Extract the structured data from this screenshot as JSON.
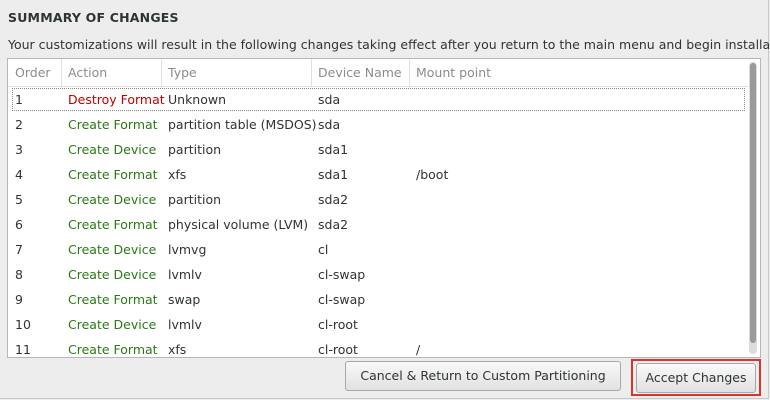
{
  "dialog": {
    "title": "SUMMARY OF CHANGES",
    "subtitle": "Your customizations will result in the following changes taking effect after you return to the main menu and begin installation:"
  },
  "table": {
    "columns": {
      "order": "Order",
      "action": "Action",
      "type": "Type",
      "device": "Device Name",
      "mount": "Mount point"
    },
    "rows": [
      {
        "order": "1",
        "action": "Destroy Format",
        "type": "Unknown",
        "device": "sda",
        "mount": ""
      },
      {
        "order": "2",
        "action": "Create Format",
        "type": "partition table (MSDOS)",
        "device": "sda",
        "mount": ""
      },
      {
        "order": "3",
        "action": "Create Device",
        "type": "partition",
        "device": "sda1",
        "mount": ""
      },
      {
        "order": "4",
        "action": "Create Format",
        "type": "xfs",
        "device": "sda1",
        "mount": "/boot"
      },
      {
        "order": "5",
        "action": "Create Device",
        "type": "partition",
        "device": "sda2",
        "mount": ""
      },
      {
        "order": "6",
        "action": "Create Format",
        "type": "physical volume (LVM)",
        "device": "sda2",
        "mount": ""
      },
      {
        "order": "7",
        "action": "Create Device",
        "type": "lvmvg",
        "device": "cl",
        "mount": ""
      },
      {
        "order": "8",
        "action": "Create Device",
        "type": "lvmlv",
        "device": "cl-swap",
        "mount": ""
      },
      {
        "order": "9",
        "action": "Create Format",
        "type": "swap",
        "device": "cl-swap",
        "mount": ""
      },
      {
        "order": "10",
        "action": "Create Device",
        "type": "lvmlv",
        "device": "cl-root",
        "mount": ""
      },
      {
        "order": "11",
        "action": "Create Format",
        "type": "xfs",
        "device": "cl-root",
        "mount": "/"
      }
    ]
  },
  "buttons": {
    "cancel": "Cancel & Return to Custom Partitioning",
    "accept": "Accept Changes"
  },
  "colors": {
    "destroy": "#c00000",
    "create": "#2a7a13",
    "highlight": "#e03030"
  }
}
